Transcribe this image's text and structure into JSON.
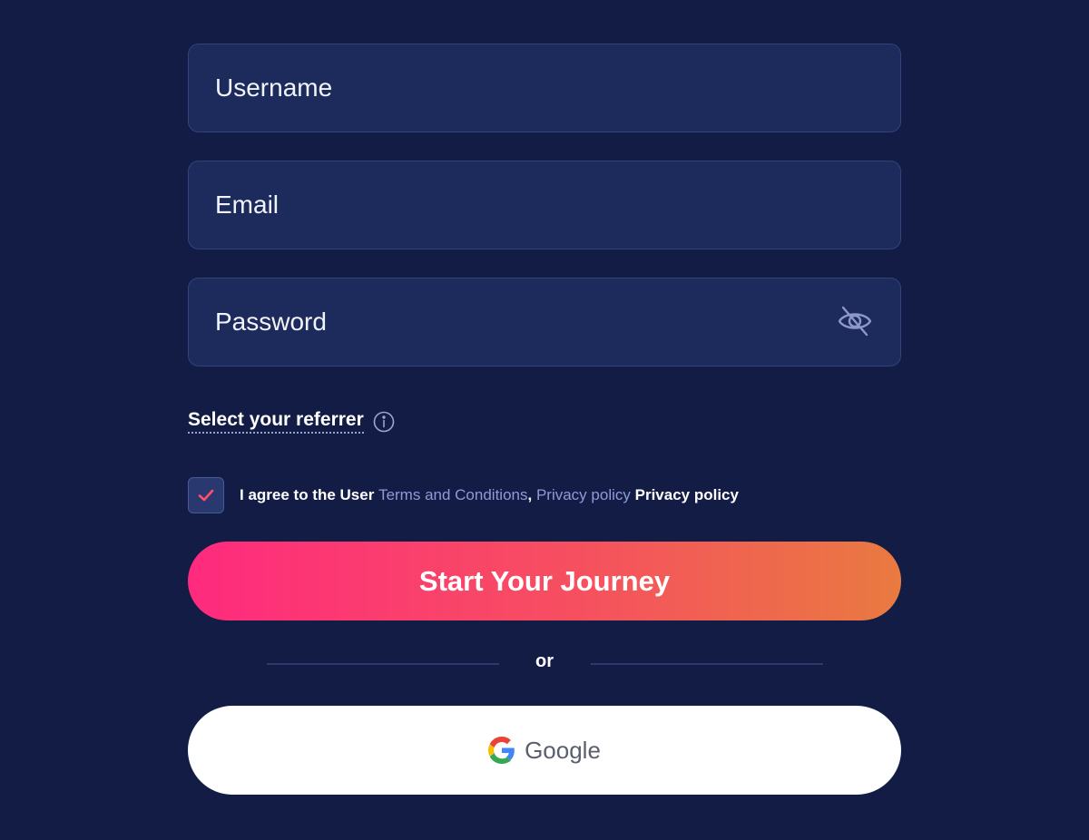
{
  "fields": {
    "username": {
      "value": "",
      "placeholder": "Username"
    },
    "email": {
      "value": "",
      "placeholder": "Email"
    },
    "password": {
      "value": "",
      "placeholder": "Password"
    }
  },
  "referrer": {
    "label": "Select your referrer",
    "icon": "info-icon"
  },
  "agreement": {
    "checked": true,
    "text_prefix": "I agree to the User",
    "terms_link": "Terms and Conditions",
    "separator": ",",
    "privacy_link": "Privacy policy",
    "privacy_bold": "Privacy policy"
  },
  "cta": {
    "label": "Start Your Journey"
  },
  "divider": {
    "label": "or"
  },
  "google": {
    "label": "Google",
    "icon": "google-icon"
  },
  "colors": {
    "background": "#121c45",
    "field_bg": "#1c2a5c",
    "accent_start": "#ff2a7e",
    "accent_end": "#e97a40",
    "link": "#8f9ad6",
    "check": "#ff4f6d"
  }
}
